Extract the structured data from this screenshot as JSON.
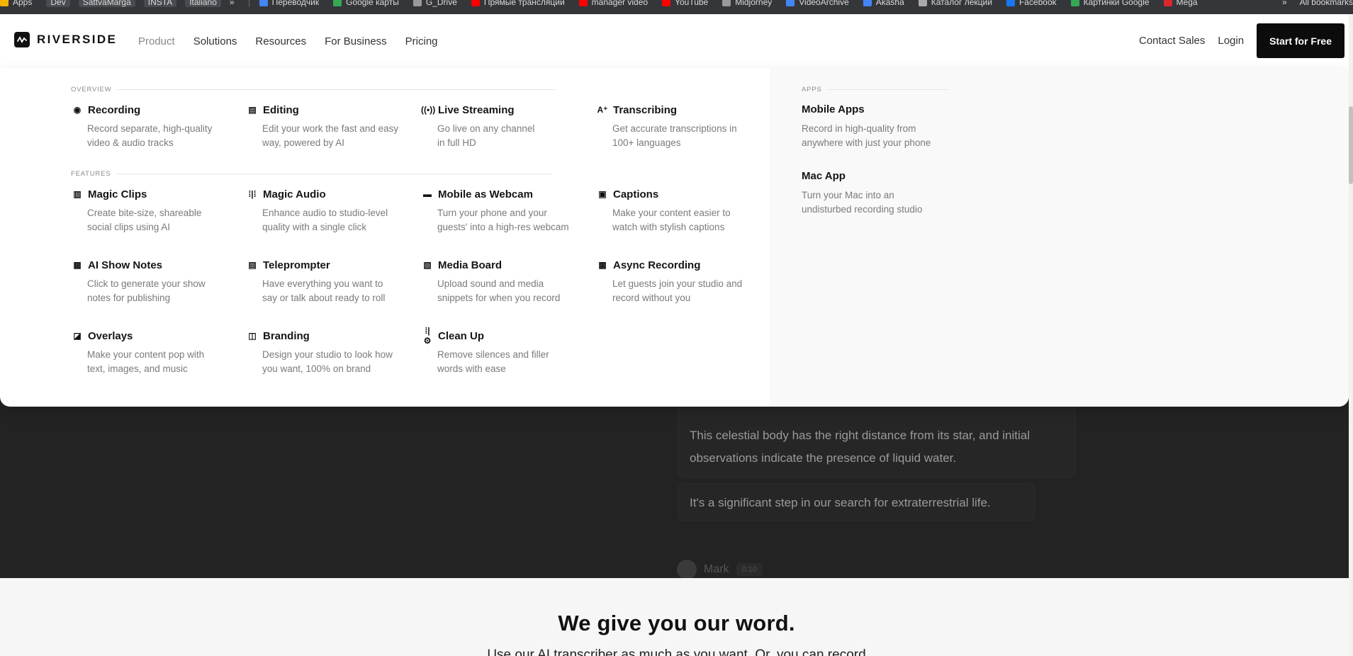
{
  "bookmarks": {
    "items": [
      {
        "label": "Apps",
        "folder": false,
        "color": "#f4b400"
      },
      {
        "label": "Dev",
        "folder": true,
        "color": "#888888"
      },
      {
        "label": "SattvaMarga",
        "folder": true,
        "color": "#888888"
      },
      {
        "label": "INSTA",
        "folder": true,
        "color": "#888888"
      },
      {
        "label": "Italiano",
        "folder": true,
        "color": "#888888"
      },
      {
        "label": "»",
        "folder": false,
        "color": "#35363a"
      }
    ],
    "links": [
      {
        "label": "Переводчик",
        "color": "#4285f4"
      },
      {
        "label": "Google карты",
        "color": "#34a853"
      },
      {
        "label": "G_Drive",
        "color": "#999999"
      },
      {
        "label": "Прямые трансляции",
        "color": "#ff0000"
      },
      {
        "label": "manager video",
        "color": "#ff0000"
      },
      {
        "label": "YouTube",
        "color": "#ff0000"
      },
      {
        "label": "Midjorney",
        "color": "#999999"
      },
      {
        "label": "VideoArchive",
        "color": "#4285f4"
      },
      {
        "label": "Akasha",
        "color": "#4285f4"
      },
      {
        "label": "Каталог лекций",
        "color": "#aaaaaa"
      },
      {
        "label": "Facebook",
        "color": "#1877f2"
      },
      {
        "label": "Картинки Google",
        "color": "#34a853"
      },
      {
        "label": "Mega",
        "color": "#d9272e"
      }
    ],
    "overflow": "»",
    "all_bookmarks": "All bookmarks"
  },
  "nav": {
    "logo_text": "RIVERSIDE",
    "links": [
      "Product",
      "Solutions",
      "Resources",
      "For Business",
      "Pricing"
    ],
    "active_index": 0,
    "contact_sales": "Contact Sales",
    "login": "Login",
    "start_free": "Start for Free"
  },
  "menu": {
    "overview_heading": "OVERVIEW",
    "features_heading": "FEATURES",
    "apps_heading": "APPS",
    "overview": [
      {
        "icon": "recording-icon",
        "glyph": "◉",
        "title": "Recording",
        "desc": "Record separate, high-quality\nvideo & audio tracks"
      },
      {
        "icon": "editing-icon",
        "glyph": "▤",
        "title": "Editing",
        "desc": "Edit your work the fast and easy\nway, powered by AI"
      },
      {
        "icon": "live-streaming-icon",
        "glyph": "((•))",
        "title": "Live Streaming",
        "desc": "Go live on any channel\nin full HD"
      },
      {
        "icon": "transcribing-icon",
        "glyph": "A⁺",
        "title": "Transcribing",
        "desc": "Get accurate transcriptions in\n100+ languages"
      }
    ],
    "features": [
      {
        "icon": "magic-clips-icon",
        "glyph": "▥",
        "title": "Magic Clips",
        "desc": "Create bite-size, shareable\n social clips using AI"
      },
      {
        "icon": "magic-audio-icon",
        "glyph": "⁞|⁞",
        "title": "Magic Audio",
        "desc": "Enhance audio to studio-level\nquality with a single click"
      },
      {
        "icon": "webcam-icon",
        "glyph": "▬",
        "title": "Mobile as Webcam",
        "desc": "Turn your phone and your\nguests' into a high-res webcam"
      },
      {
        "icon": "captions-icon",
        "glyph": "▣",
        "title": "Captions",
        "desc": "Make your content easier to\nwatch with stylish captions"
      },
      {
        "icon": "show-notes-icon",
        "glyph": "▦",
        "title": "AI Show Notes",
        "desc": "Click to generate your show\nnotes for publishing"
      },
      {
        "icon": "teleprompter-icon",
        "glyph": "▤",
        "title": "Teleprompter",
        "desc": "Have everything you want to\nsay or talk about ready to roll"
      },
      {
        "icon": "media-board-icon",
        "glyph": "▧",
        "title": "Media Board",
        "desc": "Upload sound and media\nsnippets for when you record"
      },
      {
        "icon": "async-recording-icon",
        "glyph": "▩",
        "title": "Async Recording",
        "desc": "Let guests join your studio and\nrecord without you"
      },
      {
        "icon": "overlays-icon",
        "glyph": "◪",
        "title": "Overlays",
        "desc": "Make your content pop with\ntext, images, and music"
      },
      {
        "icon": "branding-icon",
        "glyph": "◫",
        "title": "Branding",
        "desc": "Design your studio to look how\nyou want, 100% on brand"
      },
      {
        "icon": "clean-up-icon",
        "glyph": "⁞|⚙",
        "title": "Clean Up",
        "desc": "Remove silences and filler\nwords with ease"
      }
    ],
    "apps": [
      {
        "title": "Mobile Apps",
        "desc": "Record in high-quality from\nanywhere with just your phone"
      },
      {
        "title": "Mac App",
        "desc": "Turn your Mac into an\nundisturbed recording studio"
      }
    ]
  },
  "hero": {
    "bubble_1": "This celestial body has the right distance from its star, and initial observations indicate the presence of liquid water.",
    "bubble_2": "It's a significant step in our search for extraterrestrial life.",
    "speaker": "Mark",
    "time": "0:10"
  },
  "lower": {
    "heading": "We give you our word.",
    "subtext": "Use our AI transcriber as much as you want. Or, you can record"
  }
}
